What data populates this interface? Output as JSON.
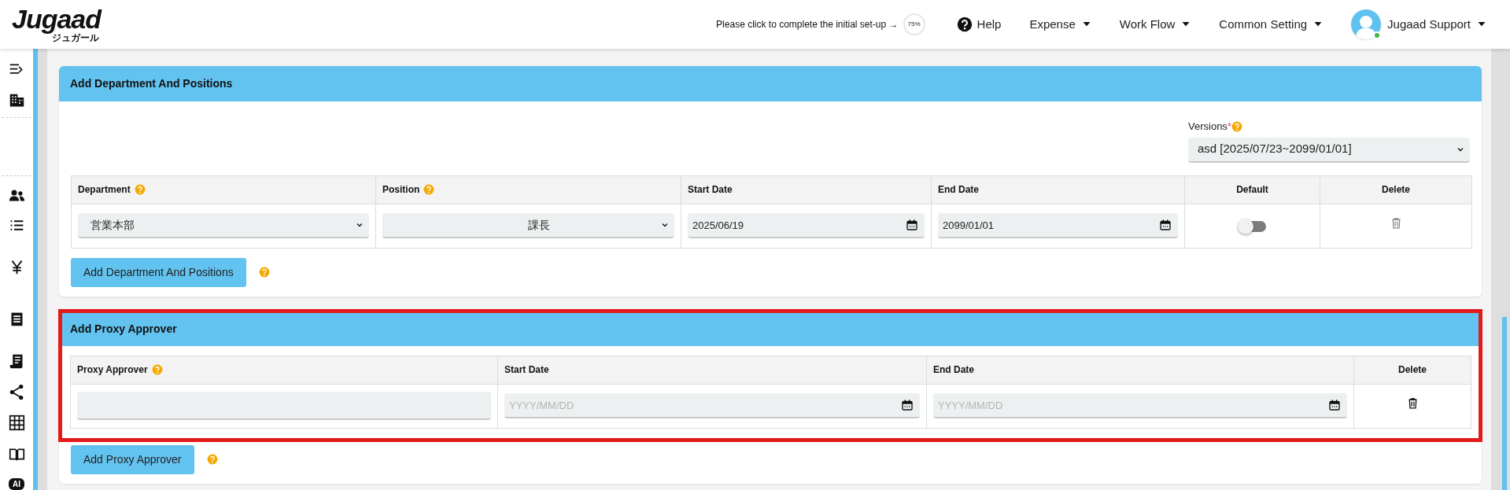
{
  "header": {
    "logo": "Jugaad",
    "logo_sub": "ジュガール",
    "setup_prompt": "Please click to complete the initial set-up →",
    "setup_progress": "75%",
    "help": "Help",
    "menus": [
      "Expense",
      "Work Flow",
      "Common Setting"
    ],
    "user": "Jugaad Support",
    "user_online": true
  },
  "sidebar": {
    "ai_label": "AI"
  },
  "department_section": {
    "title": "Add Department And Positions",
    "versions_label": "Versions",
    "versions_required_mark": "*",
    "versions_value": "asd [2025/07/23~2099/01/01]",
    "columns": [
      {
        "label": "Department",
        "help": true
      },
      {
        "label": "Position",
        "help": true
      },
      {
        "label": "Start Date",
        "help": false
      },
      {
        "label": "End Date",
        "help": false
      },
      {
        "label": "Default",
        "help": false
      },
      {
        "label": "Delete",
        "help": false
      }
    ],
    "rows": [
      {
        "department": "営業本部",
        "position": "課長",
        "start_date": "2025/06/19",
        "end_date": "2099/01/01",
        "default": false,
        "delete_disabled": true
      }
    ],
    "add_button": "Add Department And Positions"
  },
  "proxy_section": {
    "title": "Add Proxy Approver",
    "highlighted": true,
    "columns": [
      {
        "label": "Proxy Approver",
        "help": true
      },
      {
        "label": "Start Date",
        "help": false
      },
      {
        "label": "End Date",
        "help": false
      },
      {
        "label": "Delete",
        "help": false
      }
    ],
    "rows": [
      {
        "start_date_placeholder": "YYYY/MM/DD",
        "end_date_placeholder": "YYYY/MM/DD",
        "delete_disabled": false
      }
    ],
    "add_button": "Add Proxy Approver"
  }
}
